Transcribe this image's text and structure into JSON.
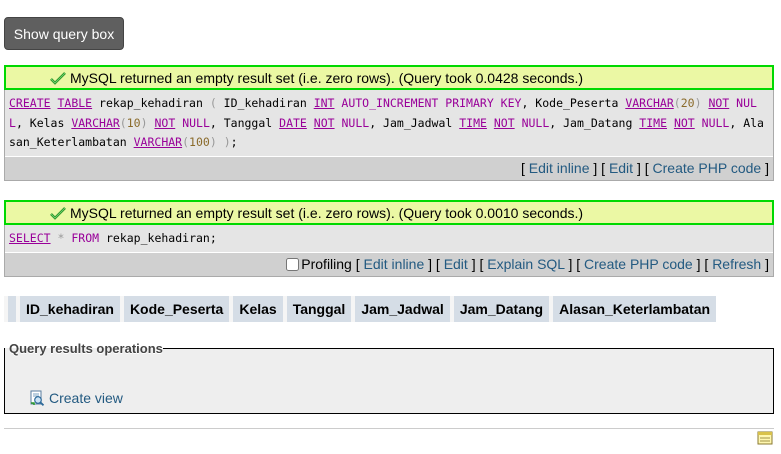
{
  "show_query_box": {
    "label": "Show query box"
  },
  "query1": {
    "message": "MySQL returned an empty result set (i.e. zero rows). (Query took 0.0428 seconds.)",
    "tools": {
      "edit_inline": "Edit inline",
      "edit": "Edit",
      "create_php": "Create PHP code"
    }
  },
  "query2": {
    "message": "MySQL returned an empty result set (i.e. zero rows). (Query took 0.0010 seconds.)",
    "tools": {
      "profiling": "Profiling",
      "edit_inline": "Edit inline",
      "edit": "Edit",
      "explain": "Explain SQL",
      "create_php": "Create PHP code",
      "refresh": "Refresh"
    }
  },
  "result_columns": [
    "ID_kehadiran",
    "Kode_Peserta",
    "Kelas",
    "Tanggal",
    "Jam_Jadwal",
    "Jam_Datang",
    "Alasan_Keterlambatan"
  ],
  "operations": {
    "legend": "Query results operations",
    "create_view": "Create view"
  },
  "colors": {
    "success_border": "#00d900",
    "success_bg": "#ebf8a4",
    "link": "#235a81",
    "keyword": "#990099"
  },
  "icons": {
    "success": "check-icon",
    "create_view": "create-view-icon",
    "console": "notepad-icon"
  }
}
